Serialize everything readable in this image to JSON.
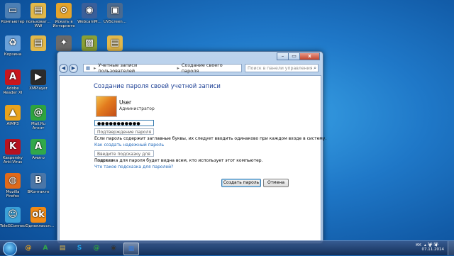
{
  "desktop": {
    "icons": [
      {
        "label": "Компьютер",
        "glyph": "▭",
        "color": "#4d7fb4"
      },
      {
        "label": "пользоват... WW",
        "glyph": "▤",
        "color": "#e2b84a"
      },
      {
        "label": "Искать в Интернете",
        "glyph": "⊙",
        "color": "#e3a42c"
      },
      {
        "label": "WebcamM...",
        "glyph": "◉",
        "color": "#3a5f9a"
      },
      {
        "label": "UVScreen...",
        "glyph": "▣",
        "color": "#4a6a90"
      },
      {
        "label": "Корзина",
        "glyph": "♻",
        "color": "#6aa0d8"
      },
      {
        "label": "",
        "glyph": "▤",
        "color": "#e2b84a"
      },
      {
        "label": "",
        "glyph": "✦",
        "color": "#6a6a6a"
      },
      {
        "label": "",
        "glyph": "▩",
        "color": "#8aa036"
      },
      {
        "label": "",
        "glyph": "▤",
        "color": "#e2b84a"
      },
      {
        "label": "Adobe Reader XI",
        "glyph": "A",
        "color": "#c8161d"
      },
      {
        "label": "XMPlayer",
        "glyph": "▶",
        "color": "#2b2b2b"
      },
      {
        "label": "AIMP3",
        "glyph": "▲",
        "color": "#e8a21b"
      },
      {
        "label": "Mail.Ru Агент",
        "glyph": "@",
        "color": "#2ea43f"
      },
      {
        "label": "Kaspersky Anti-Virus",
        "glyph": "K",
        "color": "#b7121f"
      },
      {
        "label": "Амиго",
        "glyph": "A",
        "color": "#31a84a"
      },
      {
        "label": "Mozilla Firefox",
        "glyph": "◍",
        "color": "#e06a1b"
      },
      {
        "label": "ВКонтакте",
        "glyph": "B",
        "color": "#4a76a8"
      },
      {
        "label": "TeleGConnect",
        "glyph": "☺",
        "color": "#3aa0d8"
      },
      {
        "label": "Одноклассн...",
        "glyph": "ok",
        "color": "#f28a13"
      }
    ]
  },
  "window": {
    "caption": {
      "minimize": "–",
      "maximize": "▭",
      "close": "x"
    },
    "nav": {
      "back": "◀",
      "forward": "▶"
    },
    "breadcrumb": [
      "Учетные записи пользователей",
      "Создание своего пароля"
    ],
    "search_placeholder": "Поиск в панели управления",
    "title": "Создание пароля своей учетной записи",
    "user": {
      "name": "User",
      "role": "Администратор"
    },
    "password_value": "●●●●●●●●●●●",
    "confirm_placeholder": "Подтверждение пароля",
    "note_caps": "Если пароль содержит заглавные буквы, их следует вводить одинаково при каждом входе в систему.",
    "link_strong": "Как создать надежный пароль",
    "hint_placeholder": "Введите подсказку для пароля",
    "note_hint": "Подсказка для пароля будет видна всем, кто использует этот компьютер.",
    "link_hint": "Что такое подсказка для паролей?",
    "btn_create": "Создать пароль",
    "btn_cancel": "Отмена"
  },
  "taskbar": {
    "apps": [
      {
        "name": "mailru",
        "glyph": "@",
        "color": "#e8a21b"
      },
      {
        "name": "amigo",
        "glyph": "A",
        "color": "#31a84a"
      },
      {
        "name": "folder",
        "glyph": "▤",
        "color": "#e2b84a"
      },
      {
        "name": "skype",
        "glyph": "S",
        "color": "#1fa3e8"
      },
      {
        "name": "agent",
        "glyph": "@",
        "color": "#2ea43f"
      },
      {
        "name": "obs",
        "glyph": "◉",
        "color": "#333"
      },
      {
        "name": "controlpanel",
        "glyph": "▦",
        "color": "#3a7bd5"
      }
    ],
    "lang": "КК",
    "time": "14:35",
    "date": "07.11.2014"
  }
}
